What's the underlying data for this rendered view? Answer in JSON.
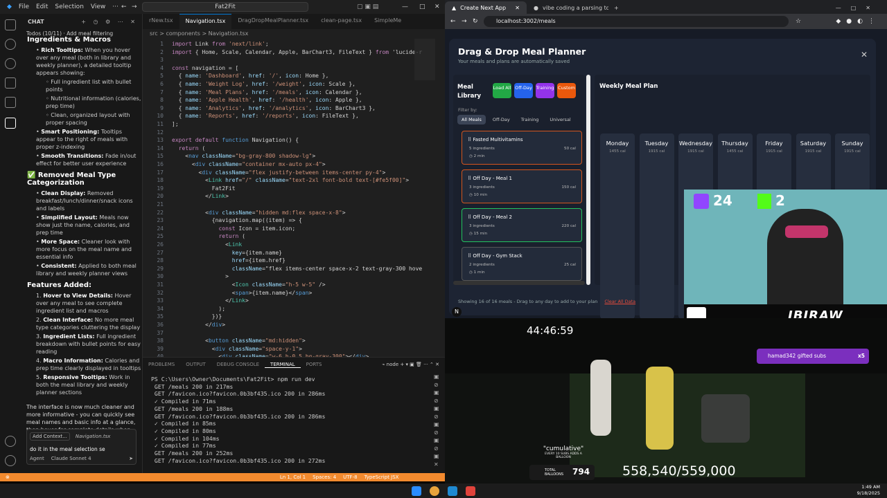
{
  "vscode": {
    "menu": [
      "File",
      "Edit",
      "Selection",
      "View"
    ],
    "search": "Fat2Fit",
    "chat_header": "CHAT",
    "todos": "Todos (10/11) · Add meal filtering",
    "chat_items": [
      {
        "kind": "partial",
        "text": "Ingredients & Macros"
      },
      {
        "kind": "bullet",
        "bold": "Rich Tooltips:",
        "text": " When you hover over any meal (both in library and weekly planner), a detailed tooltip appears showing:"
      },
      {
        "kind": "sub",
        "text": "Full ingredient list with bullet points"
      },
      {
        "kind": "sub",
        "text": "Nutritional information (calories, prep time)"
      },
      {
        "kind": "sub",
        "text": "Clean, organized layout with proper spacing"
      },
      {
        "kind": "bullet",
        "bold": "Smart Positioning:",
        "text": " Tooltips appear to the right of meals with proper z-indexing"
      },
      {
        "kind": "bullet",
        "bold": "Smooth Transitions:",
        "text": " Fade in/out effect for better user experience"
      }
    ],
    "chat_heading2": "✅ Removed Meal Type Categorization",
    "chat_items2": [
      {
        "bold": "Clean Display:",
        "text": " Removed breakfast/lunch/dinner/snack icons and labels"
      },
      {
        "bold": "Simplified Layout:",
        "text": " Meals now show just the name, calories, and prep time"
      },
      {
        "bold": "More Space:",
        "text": " Cleaner look with more focus on the meal name and essential info"
      },
      {
        "bold": "Consistent:",
        "text": " Applied to both meal library and weekly planner views"
      }
    ],
    "chat_heading3": "Features Added:",
    "chat_items3": [
      {
        "bold": "Hover to View Details:",
        "text": " Hover over any meal to see complete ingredient list and macros"
      },
      {
        "bold": "Clean Interface:",
        "text": " No more meal type categories cluttering the display"
      },
      {
        "bold": "Ingredient Lists:",
        "text": " Full ingredient breakdown with bullet points for easy reading"
      },
      {
        "bold": "Macro Information:",
        "text": " Calories and prep time clearly displayed in tooltips"
      },
      {
        "bold": "Responsive Tooltips:",
        "text": " Work in both the meal library and weekly planner sections"
      }
    ],
    "chat_summary": "The interface is now much cleaner and more informative - you can quickly see meal names and basic info at a glance, then hover for complete details when needed!",
    "chat_input": {
      "add_context": "Add Context...",
      "file": "Navigation.tsx",
      "value": "do it in the meal selection se",
      "mode": "Agent",
      "model": "Claude Sonnet 4"
    },
    "tabs": [
      "rNew.tsx",
      "Navigation.tsx",
      "DragDropMealPlanner.tsx",
      "clean-page.tsx",
      "SimpleMe"
    ],
    "active_tab": 1,
    "breadcrumb": "src > components > Navigation.tsx",
    "code_lines": [
      "import Link from 'next/link';",
      "import { Home, Scale, Calendar, Apple, BarChart3, FileText } from 'lucide-r",
      "",
      "const navigation = [",
      "  { name: 'Dashboard', href: '/', icon: Home },",
      "  { name: 'Weight Log', href: '/weight', icon: Scale },",
      "  { name: 'Meal Plans', href: '/meals', icon: Calendar },",
      "  { name: 'Apple Health', href: '/health', icon: Apple },",
      "  { name: 'Analytics', href: '/analytics', icon: BarChart3 },",
      "  { name: 'Reports', href: '/reports', icon: FileText },",
      "];",
      "",
      "export default function Navigation() {",
      "  return (",
      "    <nav className=\"bg-gray-800 shadow-lg\">",
      "      <div className=\"container mx-auto px-4\">",
      "        <div className=\"flex justify-between items-center py-4\">",
      "          <Link href=\"/\" className=\"text-2xl font-bold text-[#fe5f00]\">",
      "            Fat2Fit",
      "          </Link>",
      "",
      "          <div className=\"hidden md:flex space-x-8\">",
      "            {navigation.map((item) => {",
      "              const Icon = item.icon;",
      "              return (",
      "                <Link",
      "                  key={item.name}",
      "                  href={item.href}",
      "                  className=\"flex items-center space-x-2 text-gray-300 hove",
      "                >",
      "                  <Icon className=\"h-5 w-5\" />",
      "                  <span>{item.name}</span>",
      "                </Link>",
      "              );",
      "            })}",
      "          </div>",
      "",
      "          <button className=\"md:hidden\">",
      "            <div className=\"space-y-1\">",
      "              <div className=\"w-6 h-0.5 bg-gray-300\"></div>"
    ],
    "terminal_tabs": [
      "PROBLEMS",
      "OUTPUT",
      "DEBUG CONSOLE",
      "TERMINAL",
      "PORTS"
    ],
    "terminal_active": 3,
    "terminal_shell": "node",
    "terminal_lines": [
      "PS C:\\Users\\Owner\\Documents\\Fat2Fit> npm run dev",
      " GET /meals 200 in 217ms",
      " GET /favicon.ico?favicon.0b3bf435.ico 200 in 286ms",
      " ✓ Compiled in 71ms",
      " GET /meals 200 in 188ms",
      " GET /favicon.ico?favicon.0b3bf435.ico 200 in 286ms",
      " ✓ Compiled in 85ms",
      " ✓ Compiled in 80ms",
      " ✓ Compiled in 104ms",
      " ✓ Compiled in 77ms",
      " GET /meals 200 in 252ms",
      " GET /favicon.ico?favicon.0b3bf435.ico 200 in 272ms"
    ],
    "status": {
      "pos": "Ln 1, Col 1",
      "spaces": "Spaces: 4",
      "enc": "UTF-8",
      "lang": "TypeScript JSX"
    }
  },
  "browser": {
    "tabs": [
      "Create Next App",
      "vibe coding a parsing tool - Go"
    ],
    "url": "localhost:3002/meals"
  },
  "planner": {
    "title": "Drag & Drop Meal Planner",
    "subtitle": "Your meals and plans are automatically saved",
    "library_title": "Meal Library",
    "quick_buttons": [
      {
        "label": "Load All",
        "color": "#22a845"
      },
      {
        "label": "Off-Day",
        "color": "#2563eb"
      },
      {
        "label": "Training",
        "color": "#9333ea"
      },
      {
        "label": "Custom",
        "color": "#ea580c"
      }
    ],
    "filter_label": "Filter by:",
    "filters": [
      "All Meals",
      "Off-Day",
      "Training",
      "Universal"
    ],
    "meals": [
      {
        "name": "Fasted Multivitamins",
        "ingredients": "5 ingredients",
        "cal": "50 cal",
        "time": "2 min",
        "border": "#d4561e"
      },
      {
        "name": "Off Day - Meal 1",
        "ingredients": "3 ingredients",
        "cal": "150 cal",
        "time": "10 min",
        "border": "#d4561e"
      },
      {
        "name": "Off Day - Meal 2",
        "ingredients": "3 ingredients",
        "cal": "220 cal",
        "time": "15 min",
        "border": "#22c55e"
      },
      {
        "name": "Off Day - Gym Stack",
        "ingredients": "2 ingredients",
        "cal": "25 cal",
        "time": "1 min",
        "border": "#555"
      }
    ],
    "weekly_title": "Weekly Meal Plan",
    "days": [
      {
        "name": "Monday",
        "cal": "1455 cal"
      },
      {
        "name": "Tuesday",
        "cal": "1915 cal"
      },
      {
        "name": "Wednesday",
        "cal": "1915 cal"
      },
      {
        "name": "Thursday",
        "cal": "1455 cal"
      },
      {
        "name": "Friday",
        "cal": "1915 cal"
      },
      {
        "name": "Saturday",
        "cal": "1915 cal"
      },
      {
        "name": "Sunday",
        "cal": "1915 cal"
      }
    ],
    "footer": "Showing 16 of 16 meals - Drag to any day to add to your plan",
    "clear": "Clear All Data"
  },
  "stream": {
    "twitch_count": "24",
    "kick_count": "2",
    "brand": "IBIRAW",
    "timer": "44:46:59",
    "gift": "hamad342 gifted subs",
    "gift_mult": "x5",
    "cumulative_title": "\"cumulative\"",
    "cumulative_sub": "EVERY 10 SUBS ADDS A BALLOON",
    "balloons_label": "TOTAL BALLOONS",
    "balloons": "794",
    "progress": "558,540/559,000"
  },
  "clock": {
    "time": "1:49 AM",
    "date": "9/18/2025"
  }
}
